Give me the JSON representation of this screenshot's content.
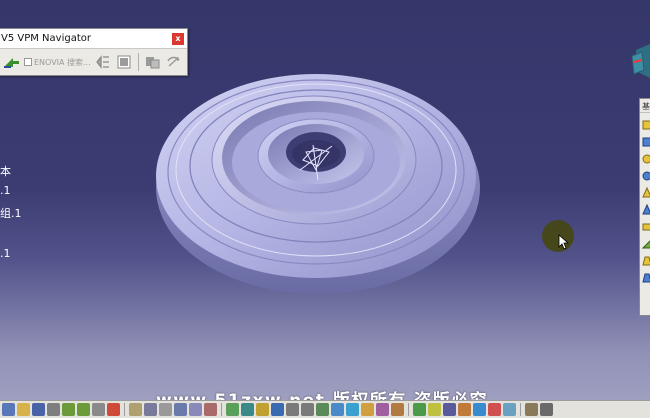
{
  "app": {
    "vpm_window_title": "V5 VPM Navigator",
    "vpm_close_label": "x",
    "enovia_search_label": "ENOVIA 搜索...",
    "right_toolbar_title": "基"
  },
  "spec_tree": {
    "items": [
      {
        "label": "本"
      },
      {
        "label": ".1"
      },
      {
        "label": "组.1"
      },
      {
        "label": ".1"
      }
    ]
  },
  "watermark": "www.51zxw.net 版权所有 盗版必究",
  "colors": {
    "background_top": "#35366a",
    "background_bottom": "#a4a4c4",
    "part_fill": "#b7b8e6",
    "part_shadow": "#6c6da8",
    "toolbar_bg": "#e4e2dc",
    "close_button": "#d9392f",
    "cursor_highlight": "#46461a"
  },
  "icons": {
    "vpm_toolbar": [
      "enovia-arrow-icon",
      "enovia-search-checkbox",
      "tree-expand-icon",
      "grid-view-icon",
      "send-to-icon",
      "refresh-icon"
    ],
    "right_toolbar": [
      "pad-icon",
      "pocket-icon",
      "shaft-icon",
      "groove-icon",
      "hole-icon",
      "rib-icon",
      "slot-icon",
      "stiffener-icon",
      "loft-icon",
      "remove-loft-icon"
    ]
  }
}
